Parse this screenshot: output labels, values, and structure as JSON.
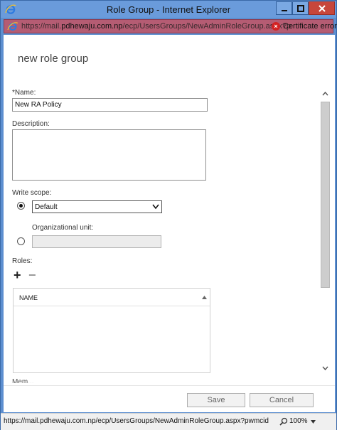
{
  "window": {
    "title": "Role Group - Internet Explorer"
  },
  "address_bar": {
    "url_prefix": "https://mail.",
    "url_host": "pdhewaju.com.np",
    "url_path": "/ecp/UsersGroups/NewAdminRoleGroup.aspx?p",
    "certificate_label": "Certificate error"
  },
  "form": {
    "title": "new role group",
    "name_label": "*Name:",
    "name_value": "New RA Policy",
    "description_label": "Description:",
    "description_value": "",
    "write_scope_label": "Write scope:",
    "write_scope_selected": "Default",
    "organizational_unit_label": "Organizational unit:",
    "roles_label": "Roles:",
    "roles_add_symbol": "+",
    "roles_remove_symbol": "−",
    "roles_column_header": "NAME",
    "cutoff_label": "Mem..."
  },
  "buttons": {
    "save_label": "Save",
    "cancel_label": "Cancel"
  },
  "status_bar": {
    "url": "https://mail.pdhewaju.com.np/ecp/UsersGroups/NewAdminRoleGroup.aspx?pwmcid",
    "zoom": "100%"
  },
  "colors": {
    "window_frame": "#5d8fd0",
    "address_bar_error": "#b55c73",
    "close_button": "#c7463b"
  }
}
